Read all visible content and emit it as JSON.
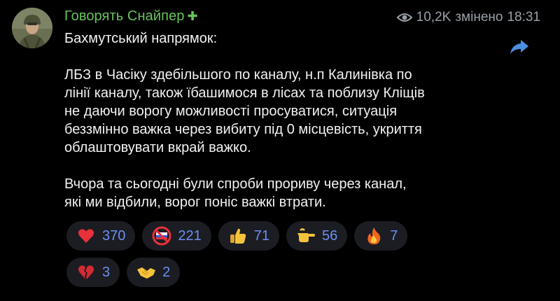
{
  "post": {
    "author": "Говорять Снайпер",
    "views": "10,2K",
    "edited_label": "змінено",
    "time": "18:31",
    "lines": [
      "Бахмутський напрямок:",
      "",
      "ЛБЗ в Часіку здебільшого по каналу, н.п Калинівка по",
      "лінії каналу, також їбашимося в лісах та поблизу Кліщів",
      "не даючи ворогу можливості просуватися, ситуація",
      "беззмінно важка через вибиту під 0 місцевість, укриття",
      "облаштовувати вкрай важко.",
      "",
      "Вчора та сьогодні були спроби прориву через канал,",
      "які ми відбили, ворог поніс важкі втрати."
    ]
  },
  "reactions": [
    {
      "icon": "red-heart-icon",
      "count": "370"
    },
    {
      "icon": "no-flag-icon",
      "count": "221"
    },
    {
      "icon": "thumbs-up-icon",
      "count": "71"
    },
    {
      "icon": "pointing-hand-icon",
      "count": "56"
    },
    {
      "icon": "fire-icon",
      "count": "7"
    },
    {
      "icon": "broken-heart-icon",
      "count": "3"
    },
    {
      "icon": "handshake-icon",
      "count": "2"
    }
  ],
  "colors": {
    "author": "#67c25c",
    "count": "#6c8ff1",
    "pill": "#1b1d22",
    "share": "#4a8fe0"
  }
}
